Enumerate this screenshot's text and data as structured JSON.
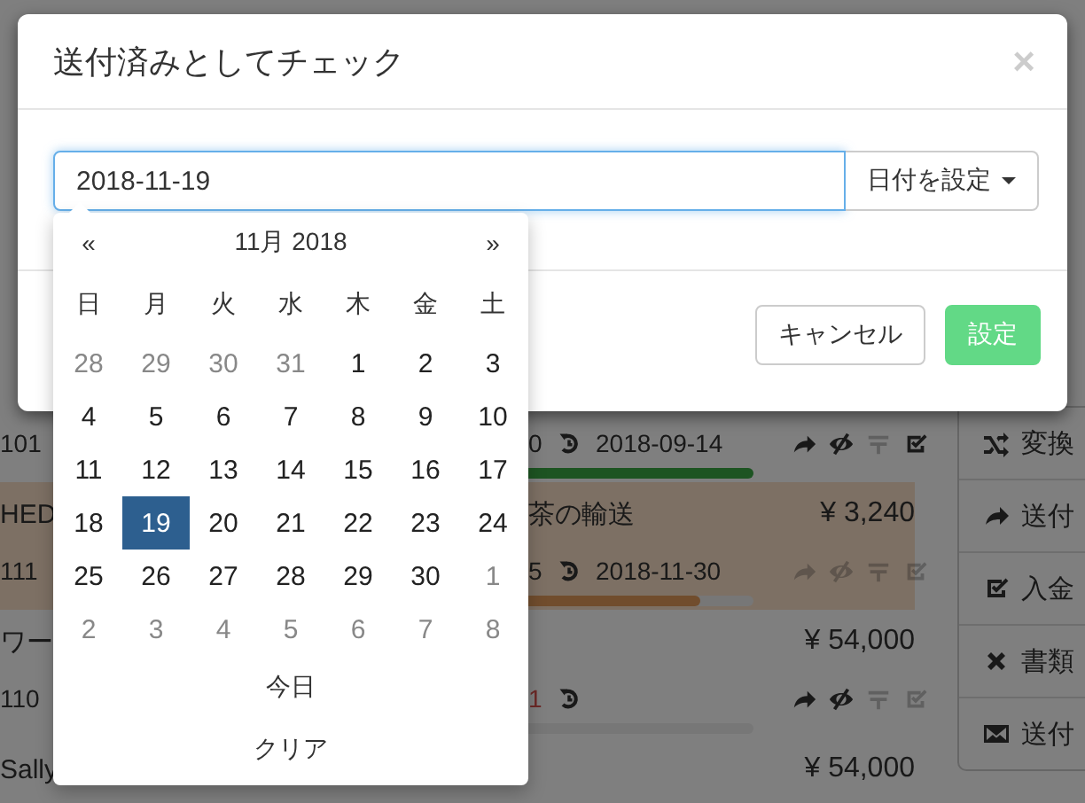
{
  "background": {
    "rows": [
      {
        "code": "101",
        "count": "0",
        "overdue": false,
        "date": "2018-09-14",
        "level": 1,
        "complete": true,
        "highlighted": false,
        "actions": [
          {
            "kind": "forward",
            "disabled": false
          },
          {
            "kind": "hide",
            "disabled": false
          },
          {
            "kind": "bars",
            "disabled": true
          },
          {
            "kind": "check",
            "disabled": false
          }
        ]
      },
      {
        "title_left": "HED",
        "title": "茶の輸送",
        "amount": "¥ 3,240",
        "code": "111",
        "count": "5",
        "overdue": false,
        "date": "2018-11-30",
        "level": 0.9,
        "complete": false,
        "highlighted": true,
        "actions": [
          {
            "kind": "forward",
            "disabled": true
          },
          {
            "kind": "hide",
            "disabled": true
          },
          {
            "kind": "bars",
            "disabled": true
          },
          {
            "kind": "check",
            "disabled": true
          }
        ]
      },
      {
        "title_left": "ワー",
        "amount": "¥ 54,000",
        "code": "110",
        "count": "1",
        "overdue": true,
        "level": 0,
        "highlighted": false,
        "actions": [
          {
            "kind": "forward",
            "disabled": false
          },
          {
            "kind": "hide",
            "disabled": false
          },
          {
            "kind": "bars",
            "disabled": true
          },
          {
            "kind": "check",
            "disabled": true
          }
        ]
      },
      {
        "title_left": "Sally",
        "amount": "¥ 54,000",
        "highlighted": false
      }
    ],
    "sidebar": {
      "items": [
        {
          "kind": "shuffle",
          "label": "変換"
        },
        {
          "kind": "forward",
          "label": "送付"
        },
        {
          "kind": "check",
          "label": "入金"
        },
        {
          "kind": "cross",
          "label": "書類"
        },
        {
          "kind": "envelope",
          "label": "送付"
        }
      ]
    }
  },
  "modal": {
    "title": "送付済みとしてチェック",
    "close": "×",
    "date_value": "2018-11-19",
    "set_date_button": "日付を設定",
    "buttons": [
      {
        "kind": "cancel",
        "label": "キャンセル"
      },
      {
        "kind": "confirm",
        "label": "設定"
      }
    ]
  },
  "datepicker": {
    "prev": "«",
    "month": "11月 2018",
    "next": "»",
    "weekdays": [
      "日",
      "月",
      "火",
      "水",
      "木",
      "金",
      "土"
    ],
    "weeks": [
      [
        {
          "day": "28",
          "muted": true,
          "selected": false
        },
        {
          "day": "29",
          "muted": true,
          "selected": false
        },
        {
          "day": "30",
          "muted": true,
          "selected": false
        },
        {
          "day": "31",
          "muted": true,
          "selected": false
        },
        {
          "day": "1",
          "muted": false,
          "selected": false
        },
        {
          "day": "2",
          "muted": false,
          "selected": false
        },
        {
          "day": "3",
          "muted": false,
          "selected": false
        }
      ],
      [
        {
          "day": "4",
          "muted": false,
          "selected": false
        },
        {
          "day": "5",
          "muted": false,
          "selected": false
        },
        {
          "day": "6",
          "muted": false,
          "selected": false
        },
        {
          "day": "7",
          "muted": false,
          "selected": false
        },
        {
          "day": "8",
          "muted": false,
          "selected": false
        },
        {
          "day": "9",
          "muted": false,
          "selected": false
        },
        {
          "day": "10",
          "muted": false,
          "selected": false
        }
      ],
      [
        {
          "day": "11",
          "muted": false,
          "selected": false
        },
        {
          "day": "12",
          "muted": false,
          "selected": false
        },
        {
          "day": "13",
          "muted": false,
          "selected": false
        },
        {
          "day": "14",
          "muted": false,
          "selected": false
        },
        {
          "day": "15",
          "muted": false,
          "selected": false
        },
        {
          "day": "16",
          "muted": false,
          "selected": false
        },
        {
          "day": "17",
          "muted": false,
          "selected": false
        }
      ],
      [
        {
          "day": "18",
          "muted": false,
          "selected": false
        },
        {
          "day": "19",
          "muted": false,
          "selected": true
        },
        {
          "day": "20",
          "muted": false,
          "selected": false
        },
        {
          "day": "21",
          "muted": false,
          "selected": false
        },
        {
          "day": "22",
          "muted": false,
          "selected": false
        },
        {
          "day": "23",
          "muted": false,
          "selected": false
        },
        {
          "day": "24",
          "muted": false,
          "selected": false
        }
      ],
      [
        {
          "day": "25",
          "muted": false,
          "selected": false
        },
        {
          "day": "26",
          "muted": false,
          "selected": false
        },
        {
          "day": "27",
          "muted": false,
          "selected": false
        },
        {
          "day": "28",
          "muted": false,
          "selected": false
        },
        {
          "day": "29",
          "muted": false,
          "selected": false
        },
        {
          "day": "30",
          "muted": false,
          "selected": false
        },
        {
          "day": "1",
          "muted": true,
          "selected": false
        }
      ],
      [
        {
          "day": "2",
          "muted": true,
          "selected": false
        },
        {
          "day": "3",
          "muted": true,
          "selected": false
        },
        {
          "day": "4",
          "muted": true,
          "selected": false
        },
        {
          "day": "5",
          "muted": true,
          "selected": false
        },
        {
          "day": "6",
          "muted": true,
          "selected": false
        },
        {
          "day": "7",
          "muted": true,
          "selected": false
        },
        {
          "day": "8",
          "muted": true,
          "selected": false
        }
      ]
    ],
    "today": "今日",
    "clear": "クリア"
  }
}
